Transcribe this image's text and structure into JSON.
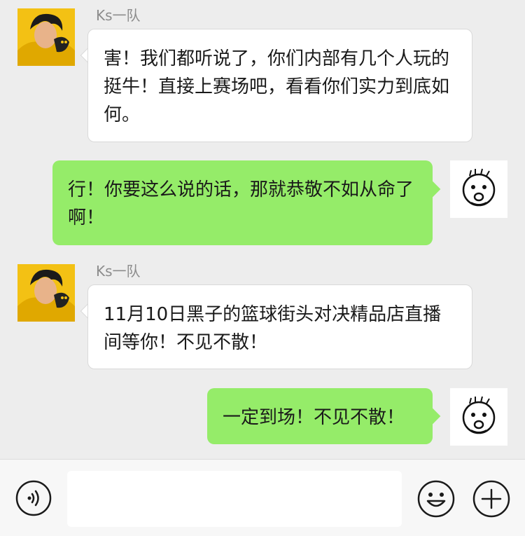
{
  "messages": [
    {
      "direction": "in",
      "sender": "Ks一队",
      "text": "害！我们都听说了，你们内部有几个人玩的挺牛！直接上赛场吧，看看你们实力到底如何。"
    },
    {
      "direction": "out",
      "sender": "",
      "text": "行！你要这么说的话，那就恭敬不如从命了啊！"
    },
    {
      "direction": "in",
      "sender": "Ks一队",
      "text": "11月10日黑子的篮球街头对决精品店直播间等你！不见不散！"
    },
    {
      "direction": "out",
      "sender": "",
      "text": "一定到场！不见不散！"
    }
  ],
  "input": {
    "placeholder": ""
  },
  "icons": {
    "voice": "voice-icon",
    "emoji": "emoji-icon",
    "plus": "plus-icon",
    "avatar_in": "anime-boy-avatar",
    "avatar_out": "doodle-face-avatar"
  },
  "colors": {
    "background": "#ededed",
    "bubble_in": "#ffffff",
    "bubble_out": "#95ec69",
    "sender_name": "#8c8c8c"
  }
}
